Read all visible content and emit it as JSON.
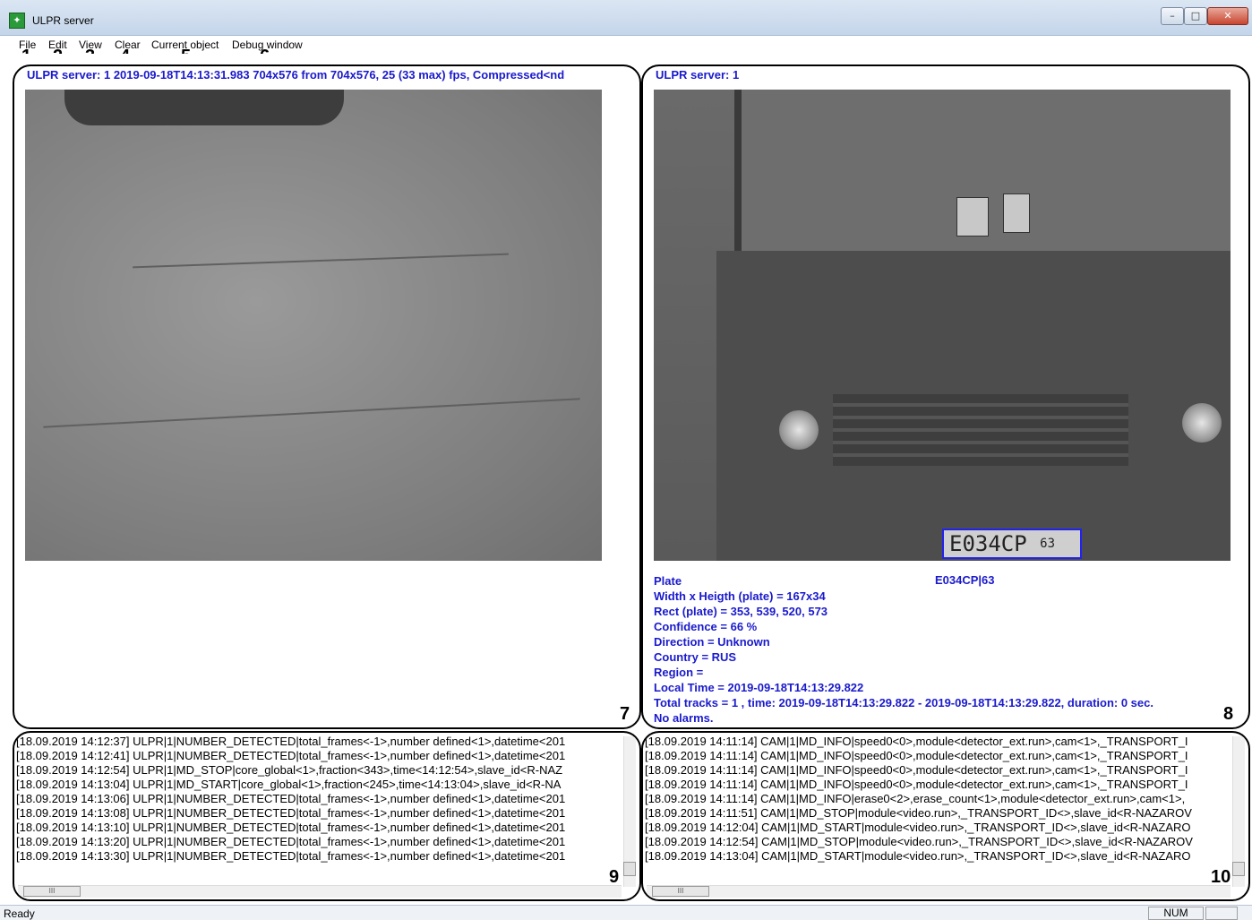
{
  "window": {
    "title": "ULPR server",
    "minimize": "–",
    "maximize": "□",
    "close": "✕"
  },
  "menu": [
    "File",
    "Edit",
    "View",
    "Clear",
    "Current object",
    "Debug window"
  ],
  "callouts": [
    "1",
    "2",
    "3",
    "4",
    "5",
    "6",
    "7",
    "8",
    "9",
    "10"
  ],
  "left_panel": {
    "header": "ULPR server: 1 2019-09-18T14:13:31.983 704x576 from 704x576, 25 (33 max) fps, Compressed<nd"
  },
  "right_panel": {
    "header": "ULPR server: 1",
    "plate_image_text": "E034CP",
    "plate_image_region": "63",
    "info": {
      "plate_label": "Plate",
      "plate_value": "E034CP|63",
      "lines": [
        "Width x Heigth (plate) = 167x34",
        "Rect (plate) = 353, 539, 520, 573",
        "Confidence = 66 %",
        "Direction = Unknown",
        "Country = RUS",
        "Region =",
        "Local Time = 2019-09-18T14:13:29.822",
        "Total tracks = 1 , time: 2019-09-18T14:13:29.822 - 2019-09-18T14:13:29.822, duration: 0 sec.",
        "No alarms."
      ]
    }
  },
  "log_left": [
    "[18.09.2019 14:12:37] ULPR|1|NUMBER_DETECTED|total_frames<-1>,number defined<1>,datetime<201",
    "[18.09.2019 14:12:41] ULPR|1|NUMBER_DETECTED|total_frames<-1>,number defined<1>,datetime<201",
    "[18.09.2019 14:12:54] ULPR|1|MD_STOP|core_global<1>,fraction<343>,time<14:12:54>,slave_id<R-NAZ",
    "[18.09.2019 14:13:04] ULPR|1|MD_START|core_global<1>,fraction<245>,time<14:13:04>,slave_id<R-NA",
    "[18.09.2019 14:13:06] ULPR|1|NUMBER_DETECTED|total_frames<-1>,number defined<1>,datetime<201",
    "[18.09.2019 14:13:08] ULPR|1|NUMBER_DETECTED|total_frames<-1>,number defined<1>,datetime<201",
    "[18.09.2019 14:13:10] ULPR|1|NUMBER_DETECTED|total_frames<-1>,number defined<1>,datetime<201",
    "[18.09.2019 14:13:20] ULPR|1|NUMBER_DETECTED|total_frames<-1>,number defined<1>,datetime<201",
    "[18.09.2019 14:13:30] ULPR|1|NUMBER_DETECTED|total_frames<-1>,number defined<1>,datetime<201"
  ],
  "log_right": [
    "[18.09.2019 14:11:14] CAM|1|MD_INFO|speed0<0>,module<detector_ext.run>,cam<1>,_TRANSPORT_I",
    "[18.09.2019 14:11:14] CAM|1|MD_INFO|speed0<0>,module<detector_ext.run>,cam<1>,_TRANSPORT_I",
    "[18.09.2019 14:11:14] CAM|1|MD_INFO|speed0<0>,module<detector_ext.run>,cam<1>,_TRANSPORT_I",
    "[18.09.2019 14:11:14] CAM|1|MD_INFO|speed0<0>,module<detector_ext.run>,cam<1>,_TRANSPORT_I",
    "[18.09.2019 14:11:14] CAM|1|MD_INFO|erase0<2>,erase_count<1>,module<detector_ext.run>,cam<1>,",
    "[18.09.2019 14:11:51] CAM|1|MD_STOP|module<video.run>,_TRANSPORT_ID<>,slave_id<R-NAZAROV",
    "[18.09.2019 14:12:04] CAM|1|MD_START|module<video.run>,_TRANSPORT_ID<>,slave_id<R-NAZARO",
    "[18.09.2019 14:12:54] CAM|1|MD_STOP|module<video.run>,_TRANSPORT_ID<>,slave_id<R-NAZAROV",
    "[18.09.2019 14:13:04] CAM|1|MD_START|module<video.run>,_TRANSPORT_ID<>,slave_id<R-NAZARO"
  ],
  "status": {
    "text": "Ready",
    "num": "NUM"
  },
  "scroll_thumb_grip": "III"
}
